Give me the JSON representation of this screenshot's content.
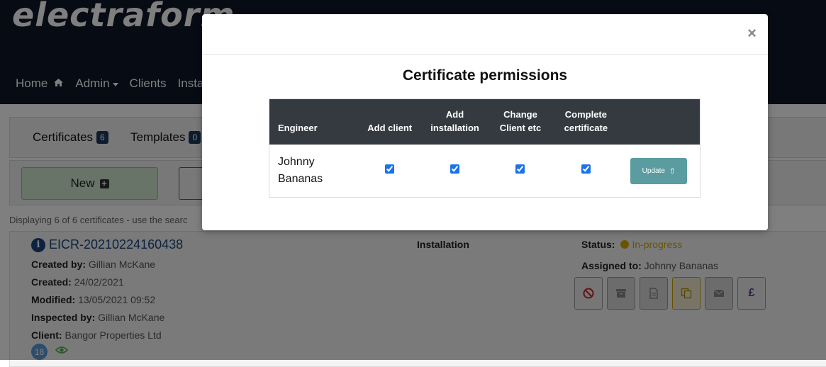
{
  "app": {
    "logo_text": "electraform"
  },
  "nav": {
    "home": "Home",
    "admin": "Admin",
    "clients": "Clients",
    "installations": "Insta"
  },
  "tabs": [
    {
      "label": "Certificates",
      "count": "6"
    },
    {
      "label": "Templates",
      "count": "0"
    }
  ],
  "actions": {
    "new_label": "New"
  },
  "listing": {
    "display_text": "Displaying 6 of 6 certificates - use the searc"
  },
  "certificate": {
    "id": "EICR-20210224160438",
    "created_by_label": "Created by:",
    "created_by": "Gillian McKane",
    "created_label": "Created:",
    "created": "24/02/2021",
    "modified_label": "Modified:",
    "modified": "13/05/2021 09:52",
    "inspected_by_label": "Inspected by:",
    "inspected_by": "Gillian McKane",
    "client_label": "Client:",
    "client": "Bangor Properties Ltd",
    "badge_count": "18",
    "installation_label": "Installation",
    "status_label": "Status:",
    "status": "In-progress",
    "assigned_label": "Assigned to:",
    "assigned_to": "Johnny Bananas",
    "currency_symbol": "£"
  },
  "modal": {
    "title": "Certificate permissions",
    "close_symbol": "×",
    "columns": {
      "engineer": "Engineer",
      "add_client": "Add client",
      "add_installation_1": "Add",
      "add_installation_2": "installation",
      "change_client_1": "Change",
      "change_client_2": "Client etc",
      "complete_cert_1": "Complete",
      "complete_cert_2": "certificate"
    },
    "rows": [
      {
        "engineer_first": "Johnny",
        "engineer_last": "Bananas",
        "add_client": true,
        "add_installation": true,
        "change_client": true,
        "complete_certificate": true,
        "update_label": "Update"
      }
    ]
  },
  "colors": {
    "header_bg": "#0e1629",
    "table_header_bg": "#343a40",
    "update_button": "#5b9ca0",
    "status_in_progress": "#d4a800",
    "link_blue": "#1a4480"
  }
}
